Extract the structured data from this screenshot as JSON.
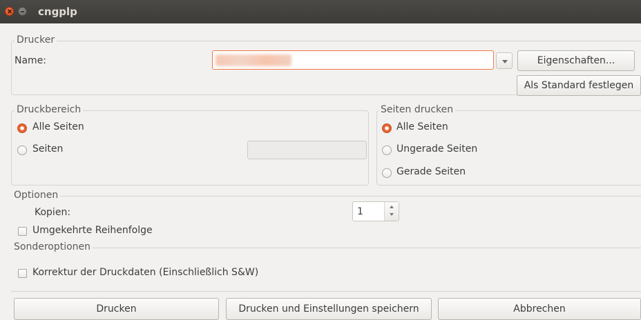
{
  "window": {
    "title": "cngplp"
  },
  "printer": {
    "legend": "Drucker",
    "name_label": "Name:",
    "properties_button": "Eigenschaften...",
    "set_default_button": "Als Standard festlegen"
  },
  "print_range": {
    "legend": "Druckbereich",
    "all_pages": "Alle Seiten",
    "pages": "Seiten",
    "selected": "all_pages"
  },
  "print_pages": {
    "legend": "Seiten drucken",
    "all_pages": "Alle Seiten",
    "odd_pages": "Ungerade Seiten",
    "even_pages": "Gerade Seiten",
    "selected": "all_pages"
  },
  "options": {
    "legend": "Optionen",
    "copies_label": "Kopien:",
    "copies_value": "1",
    "reverse_order": "Umgekehrte Reihenfolge",
    "reverse_order_checked": false
  },
  "special_options": {
    "legend": "Sonderoptionen",
    "correction": "Korrektur der Druckdaten (Einschließlich S&W)",
    "correction_checked": false
  },
  "footer": {
    "print_button": "Drucken",
    "print_save_button": "Drucken und Einstellungen speichern",
    "cancel_button": "Abbrechen"
  },
  "colors": {
    "accent": "#e35a28",
    "titlebar": "#3d3c39",
    "background": "#f2f1f0"
  },
  "icons": {
    "close": "close-icon",
    "minimize": "minimize-icon",
    "dropdown": "chevron-down-icon"
  }
}
